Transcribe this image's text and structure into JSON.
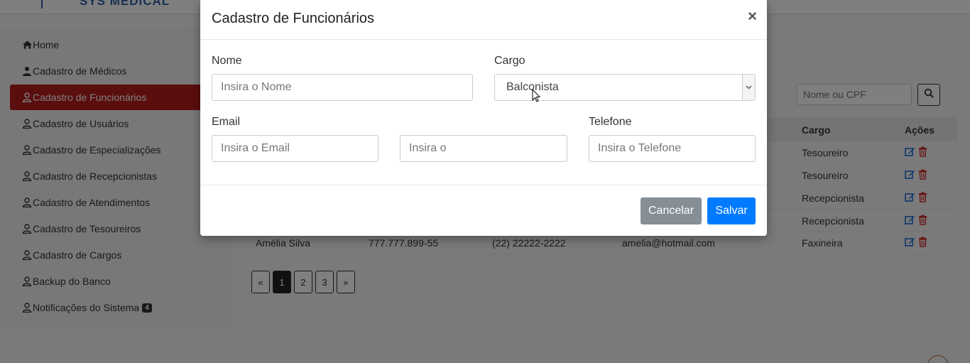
{
  "brand": {
    "name": "SYS MEDICAL"
  },
  "sidebar": {
    "items": [
      {
        "label": "Home",
        "icon": "home-icon"
      },
      {
        "label": "Cadastro de Médicos",
        "icon": "user-doctor-icon"
      },
      {
        "label": "Cadastro de Funcionários",
        "icon": "user-icon",
        "active": true
      },
      {
        "label": "Cadastro de Usuários",
        "icon": "user-icon"
      },
      {
        "label": "Cadastro de Especializações",
        "icon": "user-icon"
      },
      {
        "label": "Cadastro de Recepcionistas",
        "icon": "user-icon"
      },
      {
        "label": "Cadastro de Atendimentos",
        "icon": "user-icon"
      },
      {
        "label": "Cadastro de Tesoureiros",
        "icon": "user-icon"
      },
      {
        "label": "Cadastro de Cargos",
        "icon": "user-icon"
      },
      {
        "label": "Backup do Banco",
        "icon": "user-icon"
      },
      {
        "label": "Notificações do Sistema",
        "icon": "user-icon",
        "badge": "4"
      }
    ],
    "active_color": "#b71c1c"
  },
  "search": {
    "placeholder": "Nome ou CPF"
  },
  "table": {
    "headers": {
      "cargo": "Cargo",
      "acoes": "Ações"
    },
    "rows": [
      {
        "nome": "",
        "cpf": "",
        "telefone": "",
        "email": "",
        "cargo": "Tesoureiro"
      },
      {
        "nome": "",
        "cpf": "",
        "telefone": "",
        "email": "",
        "cargo": "Tesoureiro"
      },
      {
        "nome": "",
        "cpf": "",
        "telefone": "",
        "email": "",
        "cargo": "Recepcionista"
      },
      {
        "nome": "",
        "cpf": "",
        "telefone": "",
        "email": "",
        "cargo": "Recepcionista"
      },
      {
        "nome": "Amélia Silva",
        "cpf": "777.777.899-55",
        "telefone": "(22) 22222-2222",
        "email": "amelia@hotmail.com",
        "cargo": "Faxineira"
      }
    ],
    "edit_icon_color": "#1e6fd9",
    "delete_icon_color": "#d32f2f"
  },
  "pagination": {
    "prev": "«",
    "pages": [
      "1",
      "2",
      "3"
    ],
    "current": "1",
    "next": "»"
  },
  "modal": {
    "title": "Cadastro de Funcionários",
    "close": "×",
    "fields": {
      "nome_label": "Nome",
      "nome_placeholder": "Insira o Nome",
      "cargo_label": "Cargo",
      "cargo_value": "Balconista",
      "email_label": "Email",
      "email_placeholder": "Insira o Email",
      "cpf_placeholder": "Insira o",
      "telefone_label": "Telefone",
      "telefone_placeholder": "Insira o Telefone"
    },
    "buttons": {
      "cancel": "Cancelar",
      "save": "Salvar"
    },
    "save_color": "#007bff",
    "cancel_color": "#868e96"
  }
}
